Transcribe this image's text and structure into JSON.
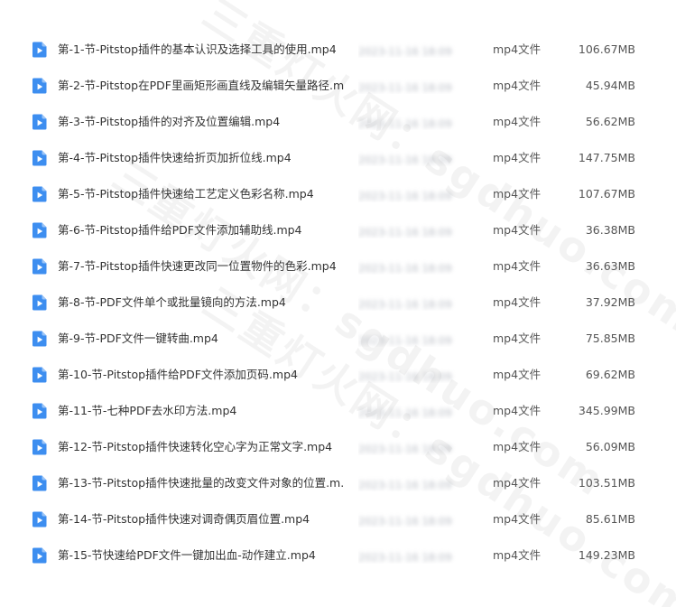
{
  "colors": {
    "icon_blue": "#3d8ef0",
    "text": "#333333",
    "muted_text": "#555555"
  },
  "icon_name": "video-file-icon",
  "date_placeholder": "2023-11-16 18:09",
  "watermark": {
    "text": "三重灯火网：sgdhuo.com"
  },
  "files": [
    {
      "name": "第-1-节-Pitstop插件的基本认识及选择工具的使用.mp4",
      "type": "mp4文件",
      "size": "106.67MB"
    },
    {
      "name": "第-2-节-Pitstop在PDF里画矩形画直线及编辑矢量路径.m...",
      "type": "mp4文件",
      "size": "45.94MB"
    },
    {
      "name": "第-3-节-Pitstop插件的对齐及位置编辑.mp4",
      "type": "mp4文件",
      "size": "56.62MB"
    },
    {
      "name": "第-4-节-Pitstop插件快速给折页加折位线.mp4",
      "type": "mp4文件",
      "size": "147.75MB"
    },
    {
      "name": "第-5-节-Pitstop插件快速给工艺定义色彩名称.mp4",
      "type": "mp4文件",
      "size": "107.67MB"
    },
    {
      "name": "第-6-节-Pitstop插件给PDF文件添加辅助线.mp4",
      "type": "mp4文件",
      "size": "36.38MB"
    },
    {
      "name": "第-7-节-Pitstop插件快速更改同一位置物件的色彩.mp4",
      "type": "mp4文件",
      "size": "36.63MB"
    },
    {
      "name": "第-8-节-PDF文件单个或批量镜向的方法.mp4",
      "type": "mp4文件",
      "size": "37.92MB"
    },
    {
      "name": "第-9-节-PDF文件一键转曲.mp4",
      "type": "mp4文件",
      "size": "75.85MB"
    },
    {
      "name": "第-10-节-Pitstop插件给PDF文件添加页码.mp4",
      "type": "mp4文件",
      "size": "69.62MB"
    },
    {
      "name": "第-11-节-七种PDF去水印方法.mp4",
      "type": "mp4文件",
      "size": "345.99MB"
    },
    {
      "name": "第-12-节-Pitstop插件快速转化空心字为正常文字.mp4",
      "type": "mp4文件",
      "size": "56.09MB"
    },
    {
      "name": "第-13-节-Pitstop插件快速批量的改变文件对象的位置.m...",
      "type": "mp4文件",
      "size": "103.51MB"
    },
    {
      "name": "第-14-节-Pitstop插件快速对调奇偶页眉位置.mp4",
      "type": "mp4文件",
      "size": "85.61MB"
    },
    {
      "name": "第-15-节快速给PDF文件一键加出血-动作建立.mp4",
      "type": "mp4文件",
      "size": "149.23MB"
    }
  ]
}
